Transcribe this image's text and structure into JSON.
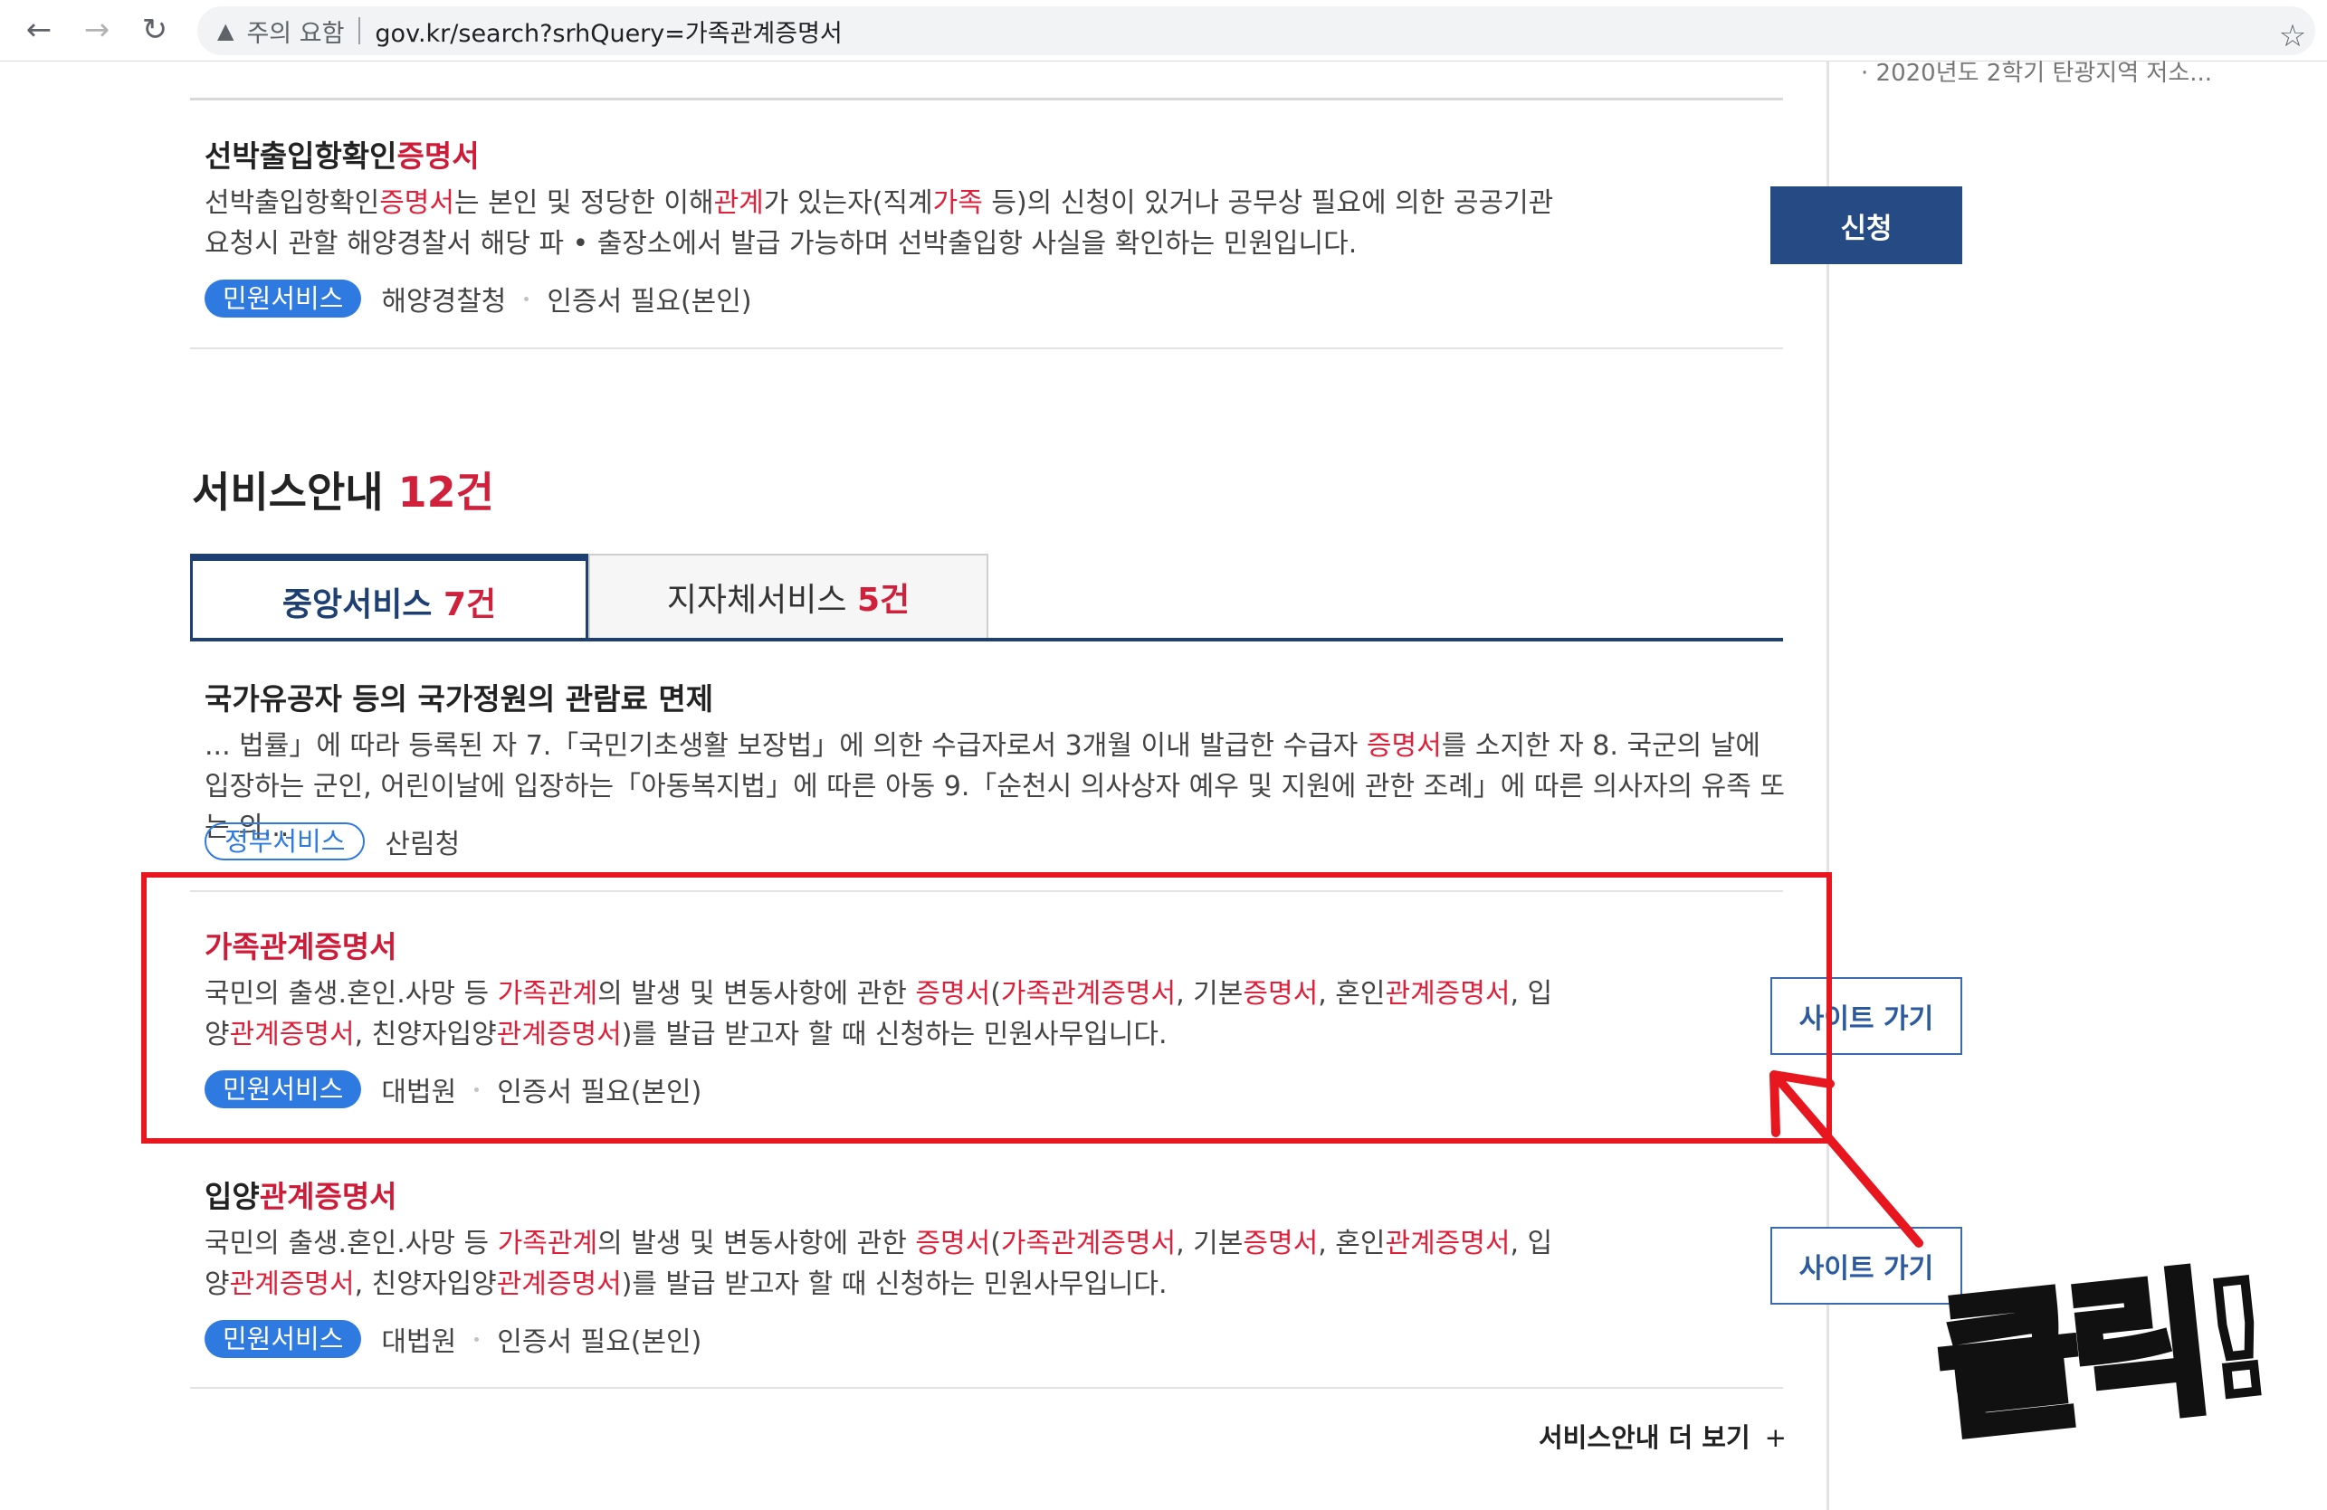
{
  "browser": {
    "warning_label": "주의 요함",
    "url": "gov.kr/search?srhQuery=가족관계증명서",
    "icons": [
      "back-arrow-icon",
      "forward-arrow-icon",
      "reload-icon",
      "warning-triangle-icon",
      "bookmark-star-icon"
    ]
  },
  "sidebar": {
    "snippet": "2020년도 2학기 탄광지역 저소..."
  },
  "top_result": {
    "title_prefix": "선박출입항확인",
    "title_highlight": "증명서",
    "desc_parts": [
      "선박출입항확인",
      "증명서",
      "는 본인 및 정당한 이해",
      "관계",
      "가 있는자(직계",
      "가족",
      " 등)의 신청이 있거나 공무상 필요에 의한 공공기관 요청시 관할 해양경찰서 해당 파 • 출장소에서 발급 가능하며 선박출입항 사실을 확인하는 민원입니다."
    ],
    "badge": "민원서비스",
    "agency": "해양경찰청",
    "cert": "인증서 필요(본인)",
    "button": "신청"
  },
  "services": {
    "title": "서비스안내",
    "count": "12건",
    "tabs": [
      {
        "label": "중앙서비스",
        "count": "7건",
        "active": true
      },
      {
        "label": "지자체서비스",
        "count": "5건",
        "active": false
      }
    ],
    "items": [
      {
        "title": "국가유공자 등의 국가정원의 관람료 면제",
        "desc_a": "... 법률」에 따라 등록된 자 7.「국민기초생활 보장법」에 의한 수급자로서 3개월 이내 발급한 수급자 ",
        "desc_hl": "증명서",
        "desc_b": "를 소지한 자 8. 국군의 날에 입장하는 군인, 어린이날에 입장하는「아동복지법」에 따른 아동 9.「순천시 의사상자 예우 및 지원에 관한 조례」에 따른 의사자의 유족 또는 의...",
        "badge": "정부서비스",
        "agency": "산림청"
      },
      {
        "title": "가족관계증명서",
        "desc_parts": [
          "국민의 출생.혼인.사망 등 ",
          "가족관계",
          "의 발생 및 변동사항에 관한 ",
          "증명서",
          "(",
          "가족관계증명서",
          ", 기본",
          "증명서",
          ", 혼인",
          "관계증명서",
          ", 입양",
          "관계증명서",
          ", 친양자입양",
          "관계증명서",
          ")를 발급 받고자 할 때 신청하는 민원사무입니다."
        ],
        "badge": "민원서비스",
        "agency": "대법원",
        "cert": "인증서 필요(본인)",
        "button": "사이트 가기"
      },
      {
        "title_prefix": "입양",
        "title_highlight": "관계증명서",
        "desc_parts": [
          "국민의 출생.혼인.사망 등 ",
          "가족관계",
          "의 발생 및 변동사항에 관한 ",
          "증명서",
          "(",
          "가족관계증명서",
          ", 기본",
          "증명서",
          ", 혼인",
          "관계증명서",
          ", 입양",
          "관계증명서",
          ", 친양자입양",
          "관계증명서",
          ")를 발급 받고자 할 때 신청하는 민원사무입니다."
        ],
        "badge": "민원서비스",
        "agency": "대법원",
        "cert": "인증서 필요(본인)",
        "button": "사이트 가기"
      }
    ],
    "more_label": "서비스안내 더 보기",
    "more_icon": "+"
  },
  "annotation": {
    "label": "클릭!",
    "box_color": "#e8161f"
  },
  "colors": {
    "highlight": "#e0203a",
    "navy": "#264a83",
    "badge_blue": "#2e7ae0"
  }
}
